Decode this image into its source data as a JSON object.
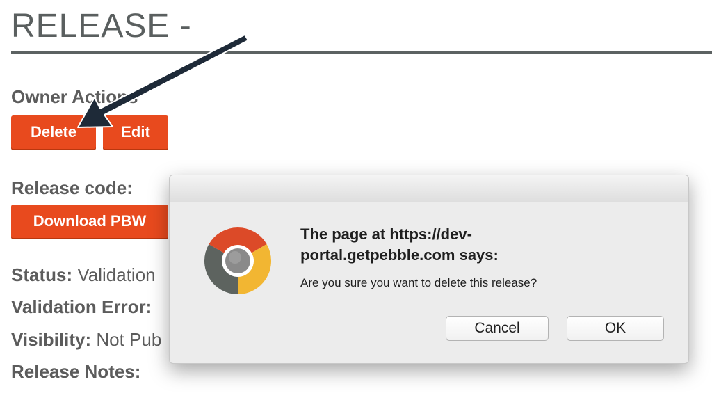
{
  "page": {
    "title": "RELEASE -"
  },
  "owner_actions": {
    "label": "Owner Actions",
    "delete_label": "Delete",
    "edit_label": "Edit"
  },
  "release_code": {
    "label": "Release code:",
    "download_label": "Download PBW"
  },
  "fields": {
    "status_key": "Status:",
    "status_value": "Validation",
    "validation_error_key": "Validation Error:",
    "visibility_key": "Visibility:",
    "visibility_value": "Not Pub",
    "release_notes_key": "Release Notes:"
  },
  "dialog": {
    "heading_line1": "The page at https://dev-",
    "heading_line2": "portal.getpebble.com says:",
    "message": "Are you sure you want to delete this release?",
    "cancel_label": "Cancel",
    "ok_label": "OK",
    "icon": "chrome-icon"
  },
  "annotation": {
    "icon": "arrow-pointer-icon",
    "color": "#1e2a38"
  },
  "colors": {
    "accent": "#e84a1e",
    "heading": "#5a5f5f"
  }
}
